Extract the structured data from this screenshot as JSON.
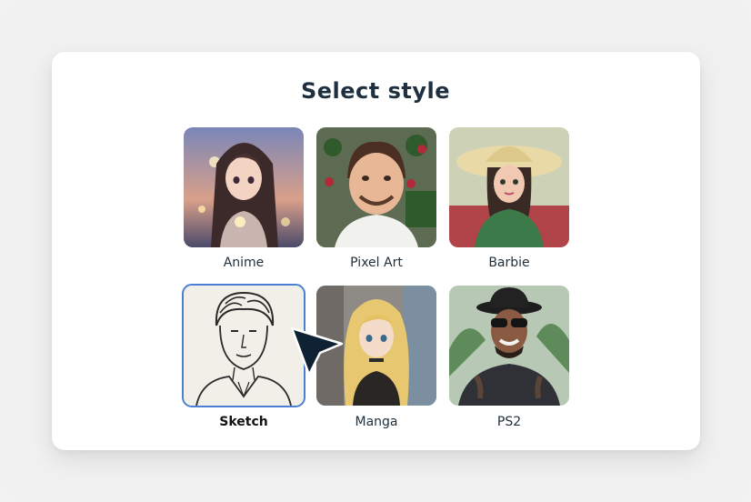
{
  "dialog": {
    "title": "Select style"
  },
  "styles": [
    {
      "label": "Anime",
      "icon": "anime-portrait-thumbnail",
      "selected": false
    },
    {
      "label": "Pixel Art",
      "icon": "pixel-art-portrait-thumbnail",
      "selected": false
    },
    {
      "label": "Barbie",
      "icon": "barbie-portrait-thumbnail",
      "selected": false
    },
    {
      "label": "Sketch",
      "icon": "sketch-portrait-thumbnail",
      "selected": true
    },
    {
      "label": "Manga",
      "icon": "manga-portrait-thumbnail",
      "selected": false
    },
    {
      "label": "PS2",
      "icon": "ps2-portrait-thumbnail",
      "selected": false
    }
  ],
  "colors": {
    "selection_border": "#4a7fd4",
    "title_text": "#1e3040",
    "cursor": "#0f2233"
  }
}
